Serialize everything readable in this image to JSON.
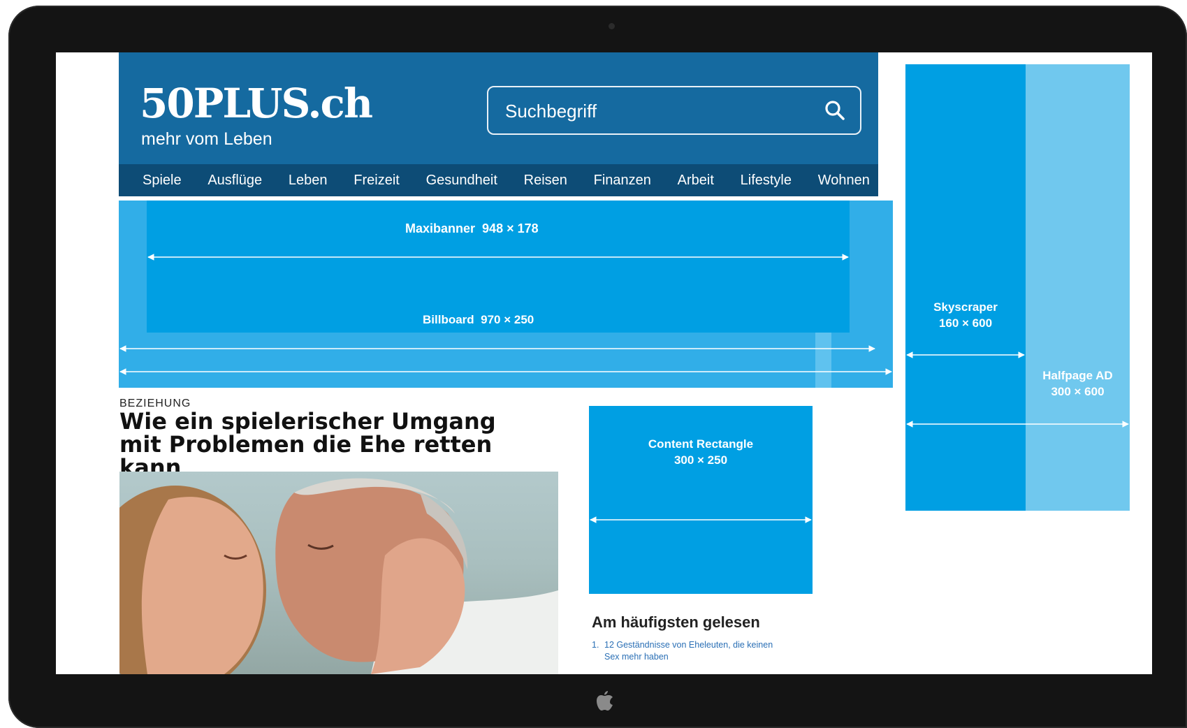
{
  "site": {
    "logo": "50PLUS.ch",
    "tagline": "mehr vom Leben",
    "search_placeholder": "Suchbegriff"
  },
  "nav": [
    "Spiele",
    "Ausflüge",
    "Leben",
    "Freizeit",
    "Gesundheit",
    "Reisen",
    "Finanzen",
    "Arbeit",
    "Lifestyle",
    "Wohnen"
  ],
  "ads": {
    "maxibanner": {
      "name": "Maxibanner",
      "size": "948 × 178"
    },
    "billboard": {
      "name": "Billboard",
      "size": "970 × 250"
    },
    "skyscraper": {
      "name": "Skyscraper",
      "size": "160 × 600"
    },
    "halfpage": {
      "name": "Halfpage AD",
      "size": "300 × 600"
    },
    "content_rectangle": {
      "name": "Content Rectangle",
      "size": "300 × 250"
    }
  },
  "article": {
    "kicker": "BEZIEHUNG",
    "headline": "Wie ein spielerischer Umgang mit Problemen die Ehe retten kann"
  },
  "popular": {
    "title": "Am häufigsten gelesen",
    "items": [
      {
        "num": "1.",
        "text": "12 Geständnisse von Eheleuten, die keinen Sex mehr haben"
      }
    ]
  },
  "colors": {
    "header": "#156aa0",
    "nav": "#0d4c76",
    "ad_primary": "#009fe3",
    "ad_light": "#70c8ee",
    "billboard": "#31aee8"
  },
  "icons": {
    "search": "search-icon",
    "apple": "apple-logo-icon",
    "camera": "camera-icon"
  }
}
